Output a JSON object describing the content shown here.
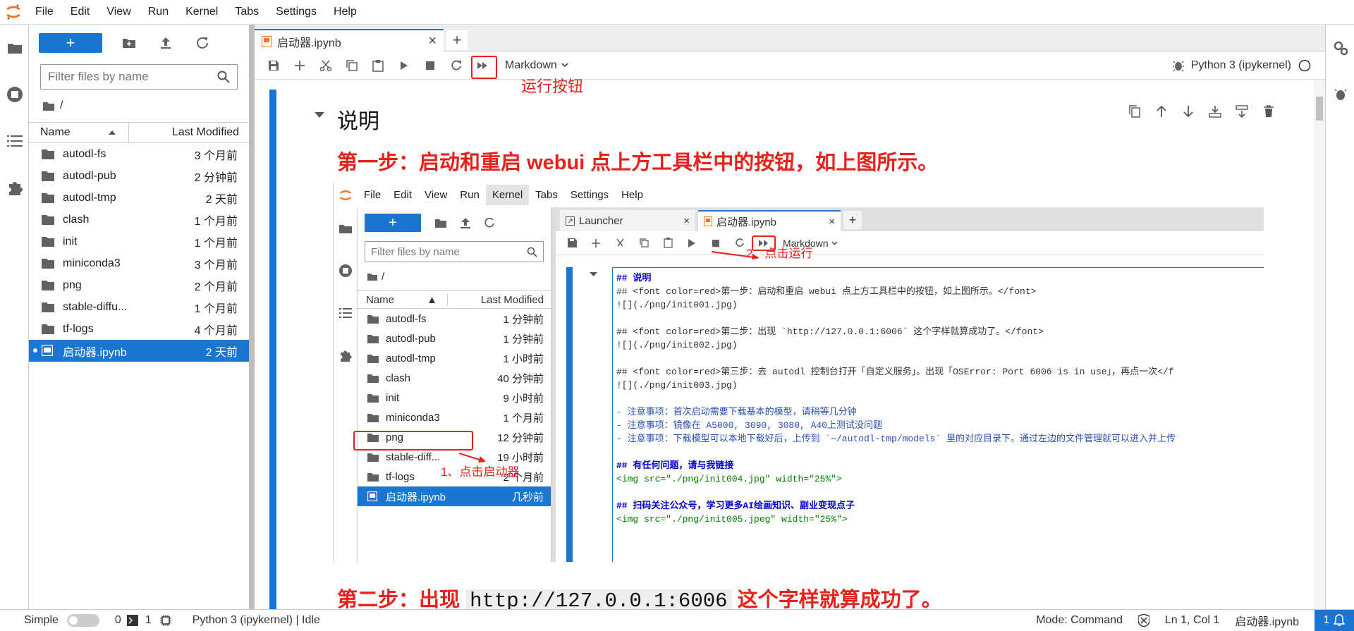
{
  "menubar": {
    "items": [
      "File",
      "Edit",
      "View",
      "Run",
      "Kernel",
      "Tabs",
      "Settings",
      "Help"
    ]
  },
  "filebrowser": {
    "new_label": "+",
    "filter_placeholder": "Filter files by name",
    "path": "/",
    "col_name": "Name",
    "col_modified": "Last Modified",
    "files": [
      {
        "name": "autodl-fs",
        "modified": "3 个月前",
        "type": "folder"
      },
      {
        "name": "autodl-pub",
        "modified": "2 分钟前",
        "type": "folder"
      },
      {
        "name": "autodl-tmp",
        "modified": "2 天前",
        "type": "folder"
      },
      {
        "name": "clash",
        "modified": "1 个月前",
        "type": "folder"
      },
      {
        "name": "init",
        "modified": "1 个月前",
        "type": "folder"
      },
      {
        "name": "miniconda3",
        "modified": "3 个月前",
        "type": "folder"
      },
      {
        "name": "png",
        "modified": "2 个月前",
        "type": "folder"
      },
      {
        "name": "stable-diffu...",
        "modified": "1 个月前",
        "type": "folder"
      },
      {
        "name": "tf-logs",
        "modified": "4 个月前",
        "type": "folder"
      },
      {
        "name": "启动器.ipynb",
        "modified": "2 天前",
        "type": "notebook",
        "selected": true
      }
    ]
  },
  "tab": {
    "title": "启动器.ipynb",
    "add": "+"
  },
  "toolbar": {
    "cell_type": "Markdown",
    "kernel": "Python 3 (ipykernel)",
    "annotation": "运行按钮"
  },
  "notebook": {
    "heading": "说明",
    "step1": "第一步：启动和重启 webui 点上方工具栏中的按钮，如上图所示。",
    "step2_a": "第二步：出现",
    "step2_code": "http://127.0.0.1:6006",
    "step2_b": "这个字样就算成功了。"
  },
  "screenshot": {
    "menu": [
      "File",
      "Edit",
      "View",
      "Run",
      "Kernel",
      "Tabs",
      "Settings",
      "Help"
    ],
    "tab_launcher": "Launcher",
    "tab_nb": "启动器.ipynb",
    "cell_type": "Markdown",
    "filter_placeholder": "Filter files by name",
    "path": "/",
    "col_name": "Name",
    "col_modified": "Last Modified",
    "files": [
      {
        "name": "autodl-fs",
        "modified": "1 分钟前"
      },
      {
        "name": "autodl-pub",
        "modified": "1 分钟前"
      },
      {
        "name": "autodl-tmp",
        "modified": "1 小时前"
      },
      {
        "name": "clash",
        "modified": "40 分钟前"
      },
      {
        "name": "init",
        "modified": "9 小时前"
      },
      {
        "name": "miniconda3",
        "modified": "1 个月前"
      },
      {
        "name": "png",
        "modified": "12 分钟前"
      },
      {
        "name": "stable-diff...",
        "modified": "19 小时前"
      },
      {
        "name": "tf-logs",
        "modified": "2 个月前"
      },
      {
        "name": "启动器.ipynb",
        "modified": "几秒前",
        "selected": true
      }
    ],
    "annot_run": "2、点击运行",
    "annot_launcher": "1、点击启动器",
    "md_lines": [
      {
        "cls": "blue",
        "text": "## 说明"
      },
      {
        "cls": "mix",
        "text": "## <font color=red>第一步：启动和重启 webui 点上方工具栏中的按钮，如上图所示。</font>"
      },
      {
        "cls": "plain",
        "text": "![](./png/init001.jpg)"
      },
      {
        "cls": "plain",
        "text": ""
      },
      {
        "cls": "mix",
        "text": "## <font color=red>第二步：出现 `http://127.0.0.1:6006` 这个字样就算成功了。</font>"
      },
      {
        "cls": "plain",
        "text": "![](./png/init002.jpg)"
      },
      {
        "cls": "plain",
        "text": ""
      },
      {
        "cls": "mix",
        "text": "## <font color=red>第三步：去 autodl 控制台打开「自定义服务」。出现「OSError: Port 6006 is in use」，再点一次</f"
      },
      {
        "cls": "plain",
        "text": "![](./png/init003.jpg)"
      },
      {
        "cls": "plain",
        "text": ""
      },
      {
        "cls": "list",
        "text": "- 注意事项：首次启动需要下载基本的模型，请稍等几分钟"
      },
      {
        "cls": "list",
        "text": "- 注意事项：镜像在 A5000, 3090, 3080, A40上测试没问题"
      },
      {
        "cls": "list",
        "text": "- 注意事项：下载模型可以本地下载好后，上传到 `~/autodl-tmp/models` 里的对应目录下。通过左边的文件管理就可以进入并上传"
      },
      {
        "cls": "plain",
        "text": ""
      },
      {
        "cls": "blue",
        "text": "## 有任何问题，请与我链接"
      },
      {
        "cls": "green",
        "text": "<img src=\"./png/init004.jpg\" width=\"25%\">"
      },
      {
        "cls": "plain",
        "text": ""
      },
      {
        "cls": "blue",
        "text": "## 扫码关注公众号，学习更多AI绘画知识、副业变现点子"
      },
      {
        "cls": "green",
        "text": "<img src=\"./png/init005.jpeg\" width=\"25%\">"
      }
    ]
  },
  "statusbar": {
    "simple": "Simple",
    "terminals": "0",
    "kernels": "1",
    "kernel_status": "Python 3 (ipykernel) | Idle",
    "mode": "Mode: Command",
    "position": "Ln 1, Col 1",
    "file": "启动器.ipynb",
    "notifications": "1"
  },
  "colors": {
    "accent": "#1976d2",
    "annotation": "#e8211c"
  }
}
